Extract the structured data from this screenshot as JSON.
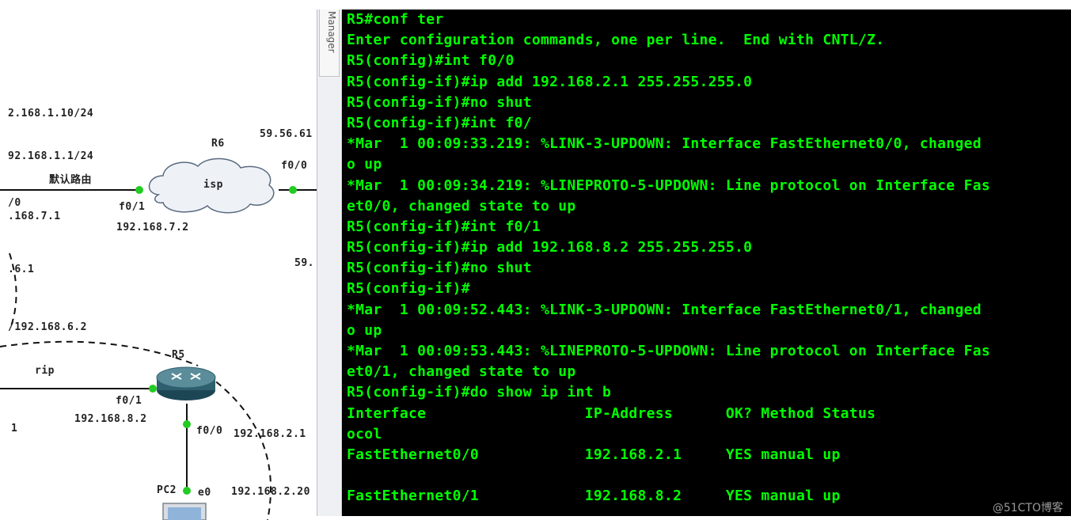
{
  "topology": {
    "labels": {
      "ip_168_1_10": "2.168.1.10/24",
      "ip_168_1_1": "92.168.1.1/24",
      "default_route": "默认路由",
      "left_iface": "/0",
      "ip_168_7_1": ".168.7.1",
      "r6_name": "R6",
      "isp_label": "isp",
      "r6_f01": "f0/1",
      "ip_168_7_2": "192.168.7.2",
      "ip_59_56": "59.56.61",
      "r6_f00": "f0/0",
      "ip_59_partial": "59.",
      "ip_6_1": ".6.1",
      "ip_168_6_2": "/192.168.6.2",
      "r5_name": "R5",
      "rip_label": "rip",
      "r5_f01": "f0/1",
      "ip_168_8_2": "192.168.8.2",
      "left_one": "1",
      "r5_f00": "f0/0",
      "ip_168_2_1": "192.168.2.1",
      "pc2_name": "PC2",
      "pc2_e0": "e0",
      "ip_168_2_20": "192.168.2.20"
    }
  },
  "manager_tab": {
    "label": "Manager"
  },
  "terminal": {
    "lines": [
      "R5#conf ter",
      "Enter configuration commands, one per line.  End with CNTL/Z.",
      "R5(config)#int f0/0",
      "R5(config-if)#ip add 192.168.2.1 255.255.255.0",
      "R5(config-if)#no shut",
      "R5(config-if)#int f0/",
      "*Mar  1 00:09:33.219: %LINK-3-UPDOWN: Interface FastEthernet0/0, changed",
      "o up",
      "*Mar  1 00:09:34.219: %LINEPROTO-5-UPDOWN: Line protocol on Interface Fas",
      "et0/0, changed state to up",
      "R5(config-if)#int f0/1",
      "R5(config-if)#ip add 192.168.8.2 255.255.255.0",
      "R5(config-if)#no shut",
      "R5(config-if)#",
      "*Mar  1 00:09:52.443: %LINK-3-UPDOWN: Interface FastEthernet0/1, changed",
      "o up",
      "*Mar  1 00:09:53.443: %LINEPROTO-5-UPDOWN: Line protocol on Interface Fas",
      "et0/1, changed state to up",
      "R5(config-if)#do show ip int b",
      "Interface                  IP-Address      OK? Method Status",
      "ocol",
      "FastEthernet0/0            192.168.2.1     YES manual up",
      "",
      "FastEthernet0/1            192.168.8.2     YES manual up"
    ],
    "text_color": "#00ff00",
    "background": "#000000"
  },
  "watermark": {
    "text": "@51CTO博客"
  },
  "colors": {
    "link_dot": "#22cc22",
    "router_body": "#2e5f6f"
  }
}
